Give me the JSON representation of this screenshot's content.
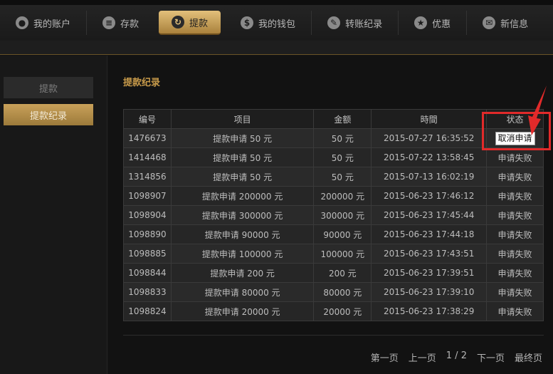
{
  "nav": {
    "items": [
      {
        "label": "我的账户",
        "icon": "person-icon",
        "glyph": "●",
        "active": false
      },
      {
        "label": "存款",
        "icon": "coins-icon",
        "glyph": "≡",
        "active": false
      },
      {
        "label": "提款",
        "icon": "withdraw-icon",
        "glyph": "↻",
        "active": true
      },
      {
        "label": "我的钱包",
        "icon": "dollar-icon",
        "glyph": "$",
        "active": false
      },
      {
        "label": "转账纪录",
        "icon": "pencil-icon",
        "glyph": "✎",
        "active": false
      },
      {
        "label": "优惠",
        "icon": "star-icon",
        "glyph": "★",
        "active": false
      },
      {
        "label": "新信息",
        "icon": "envelope-icon",
        "glyph": "✉",
        "active": false
      }
    ]
  },
  "sidebar": {
    "withdraw_label": "提款",
    "records_label": "提款纪录"
  },
  "main": {
    "title": "提款纪录",
    "table": {
      "headers": {
        "id": "编号",
        "item": "项目",
        "amount": "金额",
        "time": "時間",
        "status": "状态"
      },
      "rows": [
        {
          "id": "1476673",
          "item": "提款申请 50 元",
          "amount": "50 元",
          "time": "2015-07-27 16:35:52",
          "status": "取消申请",
          "cancelable": true
        },
        {
          "id": "1414468",
          "item": "提款申请 50 元",
          "amount": "50 元",
          "time": "2015-07-22 13:58:45",
          "status": "申请失败"
        },
        {
          "id": "1314856",
          "item": "提款申请 50 元",
          "amount": "50 元",
          "time": "2015-07-13 16:02:19",
          "status": "申请失败"
        },
        {
          "id": "1098907",
          "item": "提款申请 200000 元",
          "amount": "200000 元",
          "time": "2015-06-23 17:46:12",
          "status": "申请失败"
        },
        {
          "id": "1098904",
          "item": "提款申请 300000 元",
          "amount": "300000 元",
          "time": "2015-06-23 17:45:44",
          "status": "申请失败"
        },
        {
          "id": "1098890",
          "item": "提款申请 90000 元",
          "amount": "90000 元",
          "time": "2015-06-23 17:44:18",
          "status": "申请失败"
        },
        {
          "id": "1098885",
          "item": "提款申请 100000 元",
          "amount": "100000 元",
          "time": "2015-06-23 17:43:51",
          "status": "申请失败"
        },
        {
          "id": "1098844",
          "item": "提款申请 200 元",
          "amount": "200 元",
          "time": "2015-06-23 17:39:51",
          "status": "申请失败"
        },
        {
          "id": "1098833",
          "item": "提款申请 80000 元",
          "amount": "80000 元",
          "time": "2015-06-23 17:39:10",
          "status": "申请失败"
        },
        {
          "id": "1098824",
          "item": "提款申请 20000 元",
          "amount": "20000 元",
          "time": "2015-06-23 17:38:29",
          "status": "申请失败"
        }
      ]
    }
  },
  "pager": {
    "first": "第一页",
    "prev": "上一页",
    "current": "1 / 2",
    "next": "下一页",
    "last": "最终页"
  },
  "colors": {
    "accent_gold": "#c79a4a",
    "highlight_red": "#e12a2a"
  }
}
